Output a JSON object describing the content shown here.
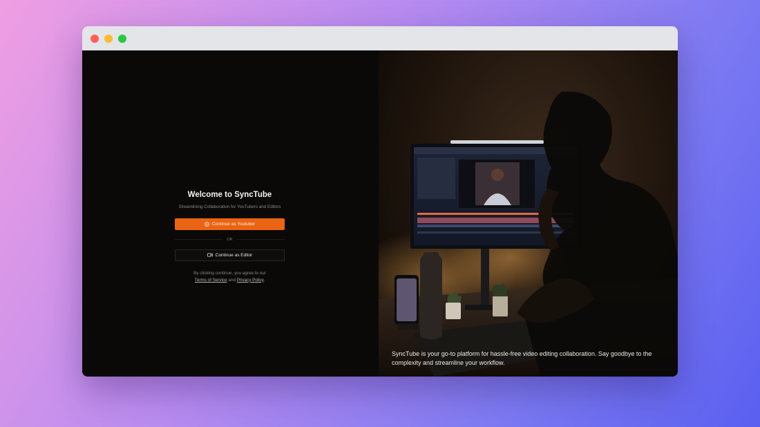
{
  "window": {
    "controls": {
      "close_color": "#ff5f57",
      "minimize_color": "#febc2e",
      "maximize_color": "#28c840"
    }
  },
  "auth": {
    "title": "Welcome to SyncTube",
    "subtitle": "Streamlining Collaboration for YouTubers and Editors",
    "youtuber_button": {
      "label": "Continue as Youtuber",
      "icon": "play-circle-icon"
    },
    "divider_text": "OR",
    "editor_button": {
      "label": "Continue as Editor",
      "icon": "video-camera-icon"
    },
    "legal_prefix": "By clicking continue, you agree to our",
    "terms_link": "Terms of Service",
    "legal_and": "and",
    "privacy_link": "Privacy Policy",
    "legal_suffix": ".",
    "accent_color": "#ea6413"
  },
  "hero": {
    "caption": "SyncTube is your go-to platform for hassle-free video editing collaboration. Say goodbye to the complexity and streamline your workflow."
  }
}
